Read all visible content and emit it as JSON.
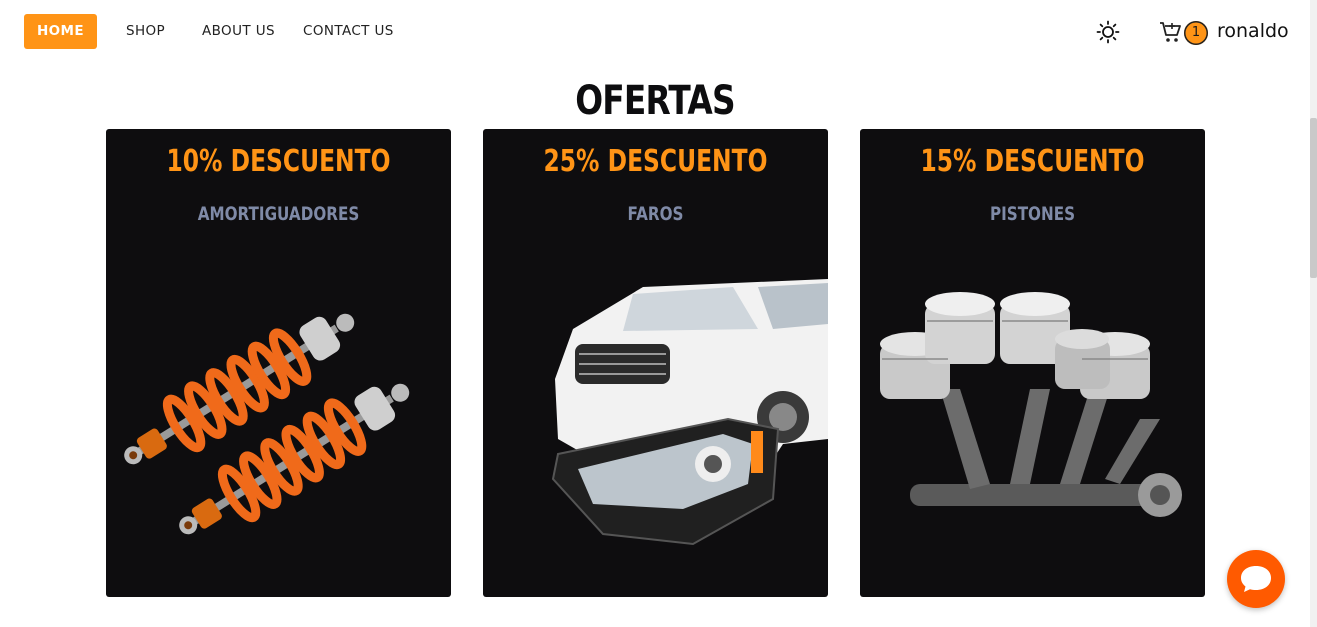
{
  "nav": {
    "items": [
      {
        "label": "HOME",
        "active": true
      },
      {
        "label": "SHOP",
        "active": false
      },
      {
        "label": "ABOUT US",
        "active": false
      },
      {
        "label": "CONTACT US",
        "active": false
      }
    ],
    "cart_count": "1",
    "username": "ronaldo",
    "icons": [
      "sun-icon",
      "cart-icon"
    ]
  },
  "page": {
    "title": "OFERTAS"
  },
  "offers": [
    {
      "discount": "10% DESCUENTO",
      "product": "AMORTIGUADORES",
      "image": "shock-absorbers"
    },
    {
      "discount": "25% DESCUENTO",
      "product": "FAROS",
      "image": "car-headlight"
    },
    {
      "discount": "15% DESCUENTO",
      "product": "PISTONES",
      "image": "engine-pistons"
    }
  ],
  "colors": {
    "accent": "#ff9416",
    "card_bg": "#0e0d0f",
    "muted": "#7f8aa7",
    "chat": "#ff5a00"
  }
}
